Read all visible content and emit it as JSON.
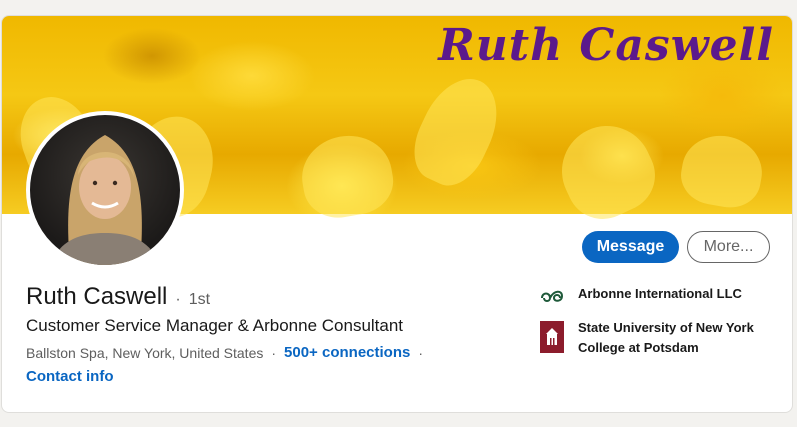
{
  "banner": {
    "title": "Ruth Caswell"
  },
  "actions": {
    "message_label": "Message",
    "more_label": "More..."
  },
  "profile": {
    "name": "Ruth Caswell",
    "degree_separator": "·",
    "degree": "1st",
    "headline": "Customer Service Manager & Arbonne Consultant",
    "location": "Ballston Spa, New York, United States",
    "location_separator": "·",
    "connections": "500+ connections",
    "connections_separator": "·",
    "contact_label": "Contact info"
  },
  "experience": [
    {
      "name": "Arbonne International LLC",
      "icon": "arbonne-logo-icon"
    },
    {
      "name_line1": "State University of New York",
      "name_line2": "College at Potsdam",
      "icon": "suny-potsdam-logo-icon"
    }
  ],
  "colors": {
    "accent": "#0a66c2",
    "banner_title": "#5b1a8c",
    "suny_maroon": "#8c1c2c",
    "arbonne_green": "#1f5a3a"
  }
}
